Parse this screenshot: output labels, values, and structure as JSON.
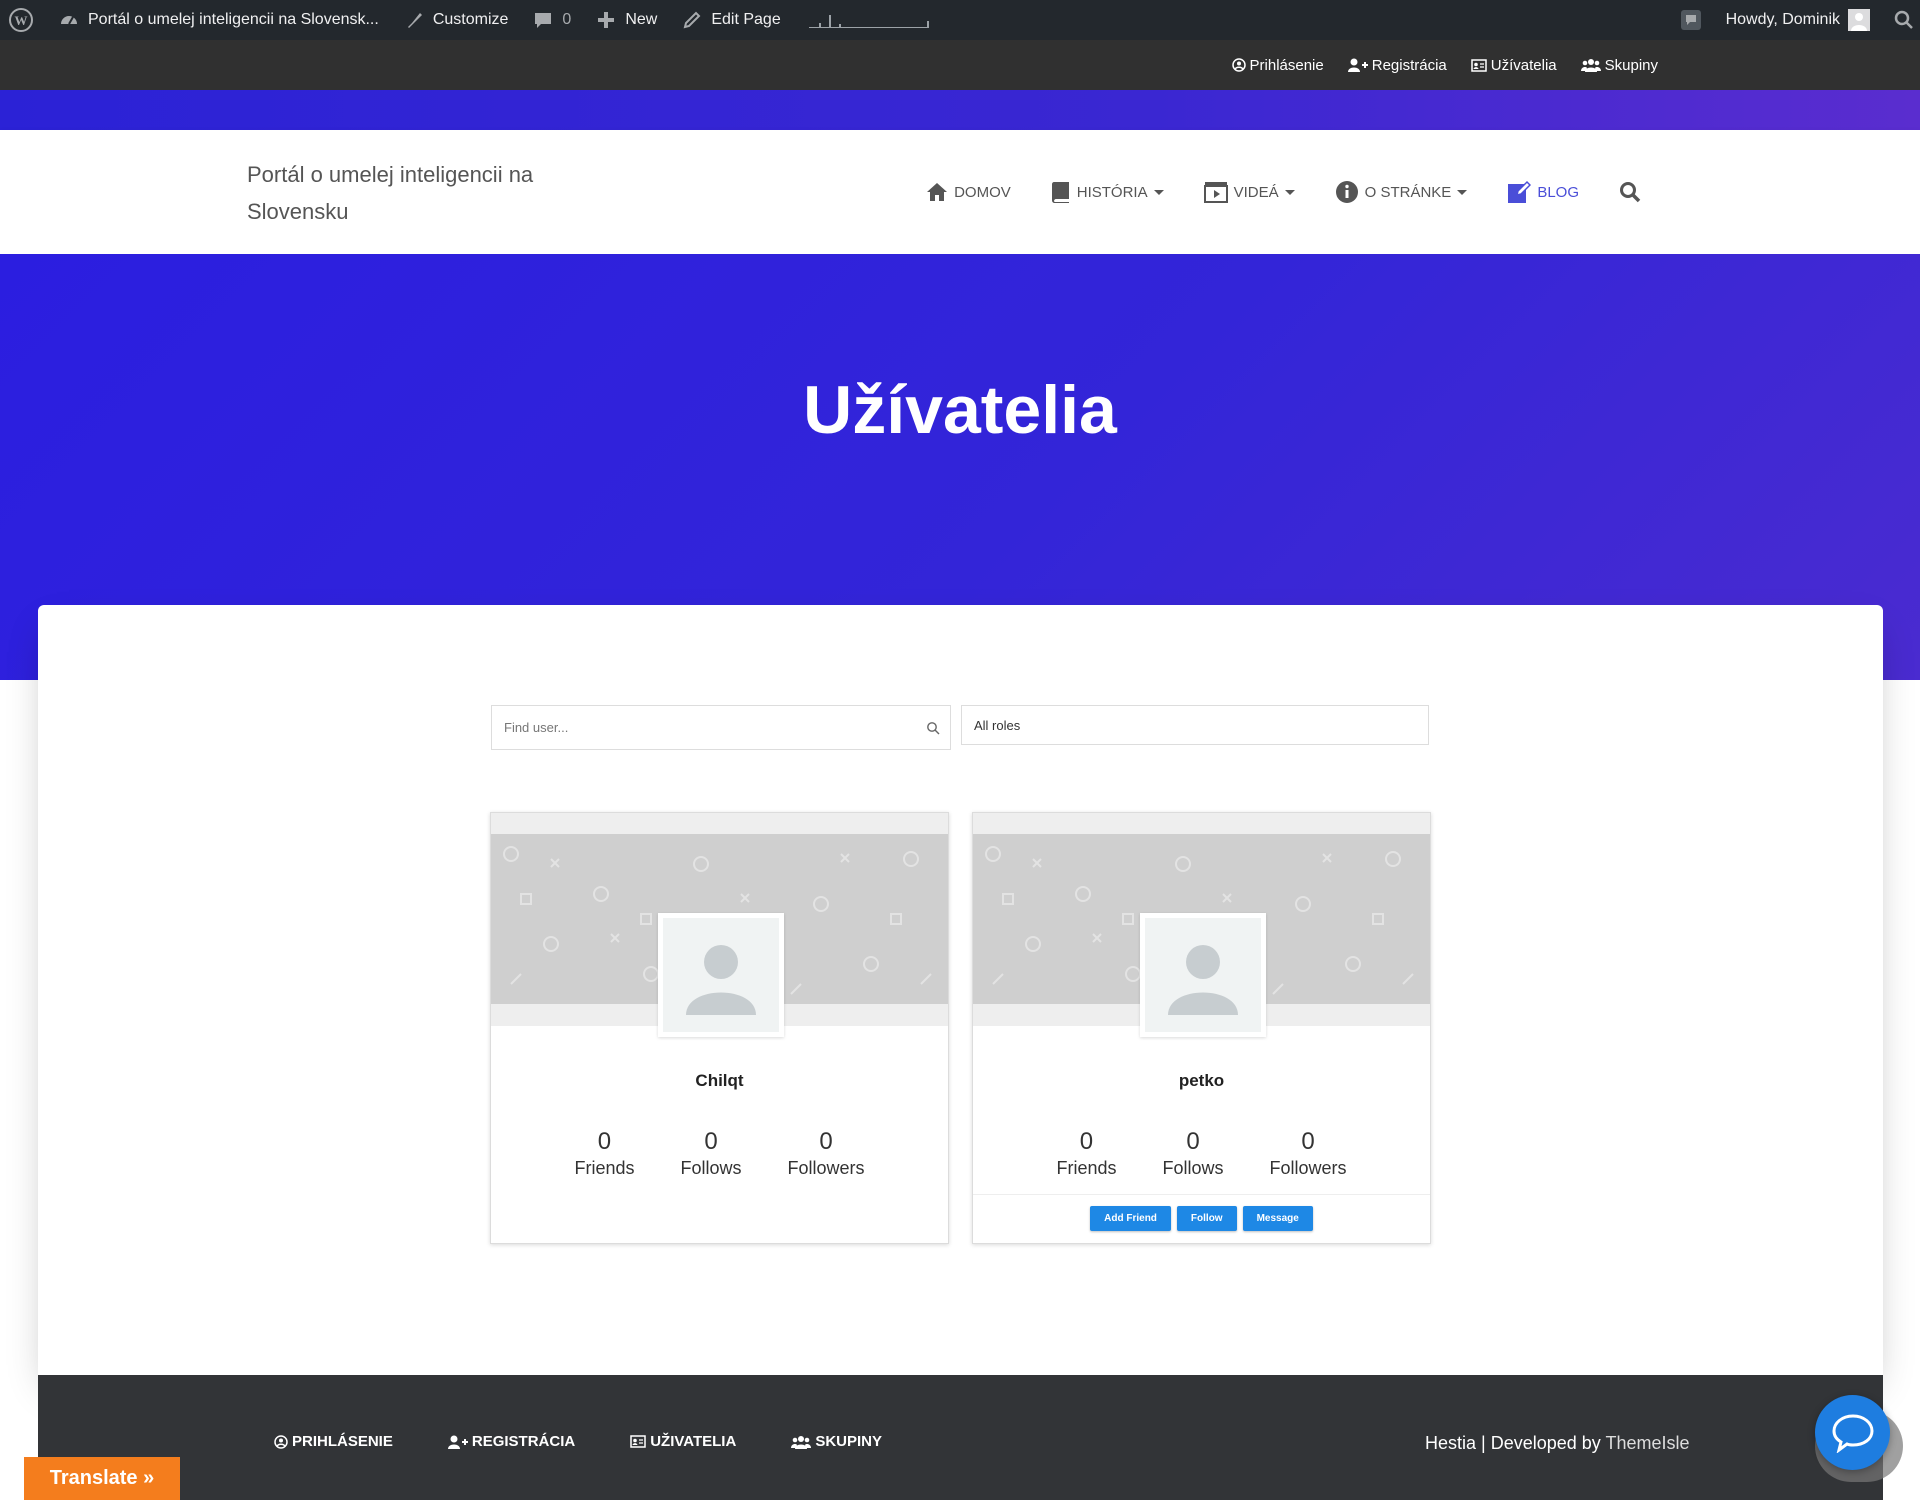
{
  "admin_bar": {
    "site_name": "Portál o umelej inteligencii na Slovensk...",
    "customize": "Customize",
    "comments_count": "0",
    "new": "New",
    "edit_page": "Edit Page",
    "howdy": "Howdy, Dominik"
  },
  "top_links": [
    "Prihlásenie",
    "Registrácia",
    "Užívatelia",
    "Skupiny"
  ],
  "nav": {
    "brand": "Portál o umelej inteligencii na Slovensku",
    "items": [
      {
        "label": "DOMOV",
        "icon": "home-icon",
        "dropdown": false
      },
      {
        "label": "HISTÓRIA",
        "icon": "book-icon",
        "dropdown": true
      },
      {
        "label": "VIDEÁ",
        "icon": "film-icon",
        "dropdown": true
      },
      {
        "label": "O STRÁNKE",
        "icon": "info-icon",
        "dropdown": true
      },
      {
        "label": "BLOG",
        "icon": "edit-icon",
        "dropdown": false
      }
    ]
  },
  "hero": {
    "title": "Užívatelia"
  },
  "filters": {
    "search_placeholder": "Find user...",
    "roles_value": "All roles"
  },
  "users": [
    {
      "name": "Chilqt",
      "friends": "0",
      "follows": "0",
      "followers": "0"
    },
    {
      "name": "petko",
      "friends": "0",
      "follows": "0",
      "followers": "0"
    }
  ],
  "stat_labels": {
    "friends": "Friends",
    "follows": "Follows",
    "followers": "Followers"
  },
  "actions": {
    "add_friend": "Add Friend",
    "follow": "Follow",
    "message": "Message"
  },
  "footer": {
    "links": [
      "PRIHLÁSENIE",
      "REGISTRÁCIA",
      "UŽIVATELIA",
      "SKUPINY"
    ],
    "credit_theme": "Hestia",
    "credit_sep": " | Developed by ",
    "credit_dev": "ThemeIsle"
  },
  "translate": {
    "label": "Translate »"
  },
  "colors": {
    "primary": "#2b1ee0",
    "button": "#1e88e5",
    "translate": "#f47d1d",
    "admin_bar": "#23282d"
  }
}
